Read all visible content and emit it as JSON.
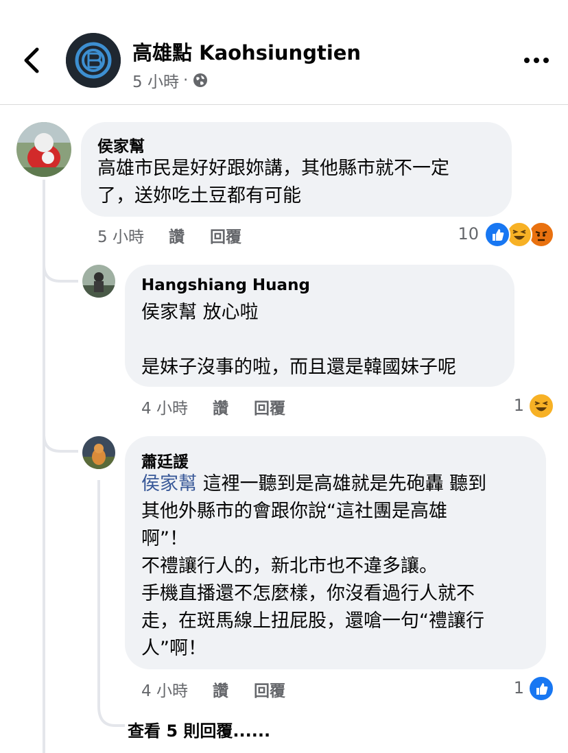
{
  "header": {
    "title": "高雄點 Kaohsiungtien",
    "time": "5 小時",
    "dot": "·"
  },
  "comments": [
    {
      "author": "侯家幫",
      "text": "高雄市民是好好跟妳講，其他縣市就不一定\n了，送妳吃土豆都有可能",
      "time": "5 小時",
      "like": "讚",
      "reply": "回覆",
      "reactions_count": "10",
      "reactions": [
        "like-icon",
        "haha-icon",
        "angry-icon"
      ]
    },
    {
      "author": "Hangshiang Huang",
      "text": "侯家幫 放心啦\n\n是妹子沒事的啦，而且還是韓國妹子呢",
      "time": "4 小時",
      "like": "讚",
      "reply": "回覆",
      "reactions_count": "1",
      "reactions": [
        "haha-icon"
      ]
    },
    {
      "author": "蕭廷諼",
      "mention": "侯家幫",
      "text": " 這裡一聽到是高雄就是先砲轟 聽到\n其他外縣市的會跟你說“這社團是高雄\n啊”！\n不禮讓行人的，新北市也不違多讓。\n手機直播還不怎麼樣，你沒看過行人就不\n走，在斑馬線上扭屁股，還嗆一句“禮讓行\n人”啊！",
      "time": "4 小時",
      "like": "讚",
      "reply": "回覆",
      "reactions_count": "1",
      "reactions": [
        "like-icon"
      ]
    }
  ],
  "view_more": "查看 5 則回覆......",
  "colors": {
    "bubble": "#f0f2f5",
    "mention": "#385898",
    "like_blue": "#1877f2",
    "haha_yellow": "#f7b125",
    "angry_orange": "#e9710f"
  }
}
